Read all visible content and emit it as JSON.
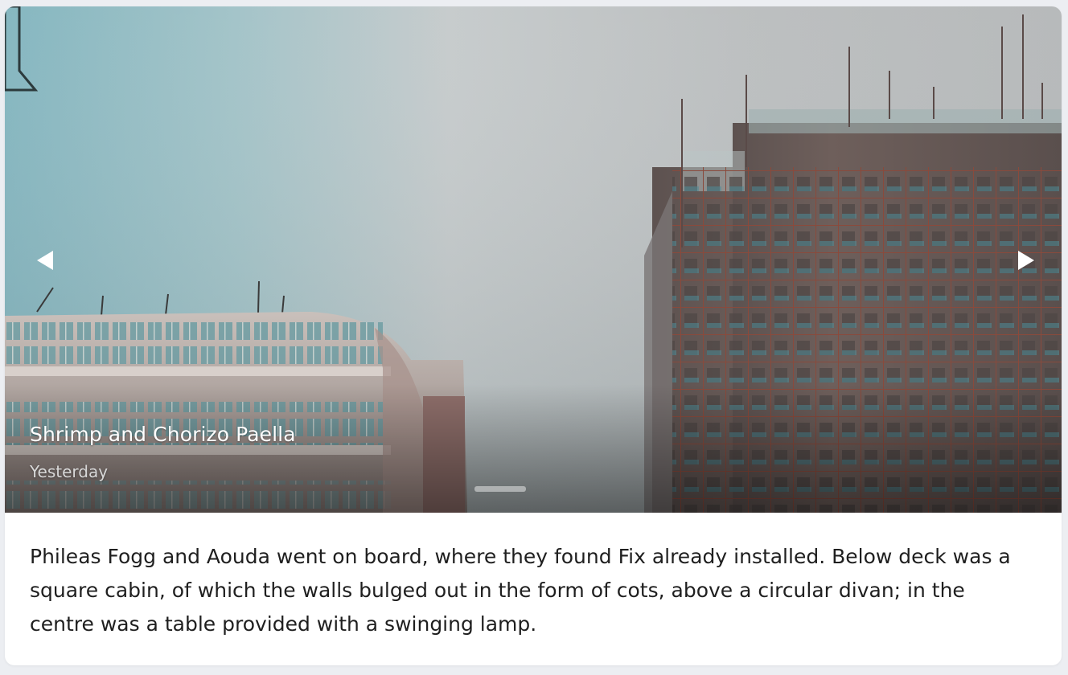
{
  "slide": {
    "title": "Shrimp and Chorizo Paella",
    "subtitle": "Yesterday",
    "prev_icon": "chevron-left-triangle-icon",
    "next_icon": "chevron-right-triangle-icon",
    "indicator_count": 1,
    "active_indicator": 1
  },
  "card": {
    "body": "Phileas Fogg and Aouda went on board, where they found Fix already installed. Below deck was a square cabin, of which the walls bulged out in the form of cots, above a circular divan; in the centre was a table provided with a swinging lamp."
  },
  "colors": {
    "page_bg": "#eceef2",
    "card_bg": "#ffffff",
    "text": "#1f1f1f",
    "caption": "#ffffff"
  }
}
